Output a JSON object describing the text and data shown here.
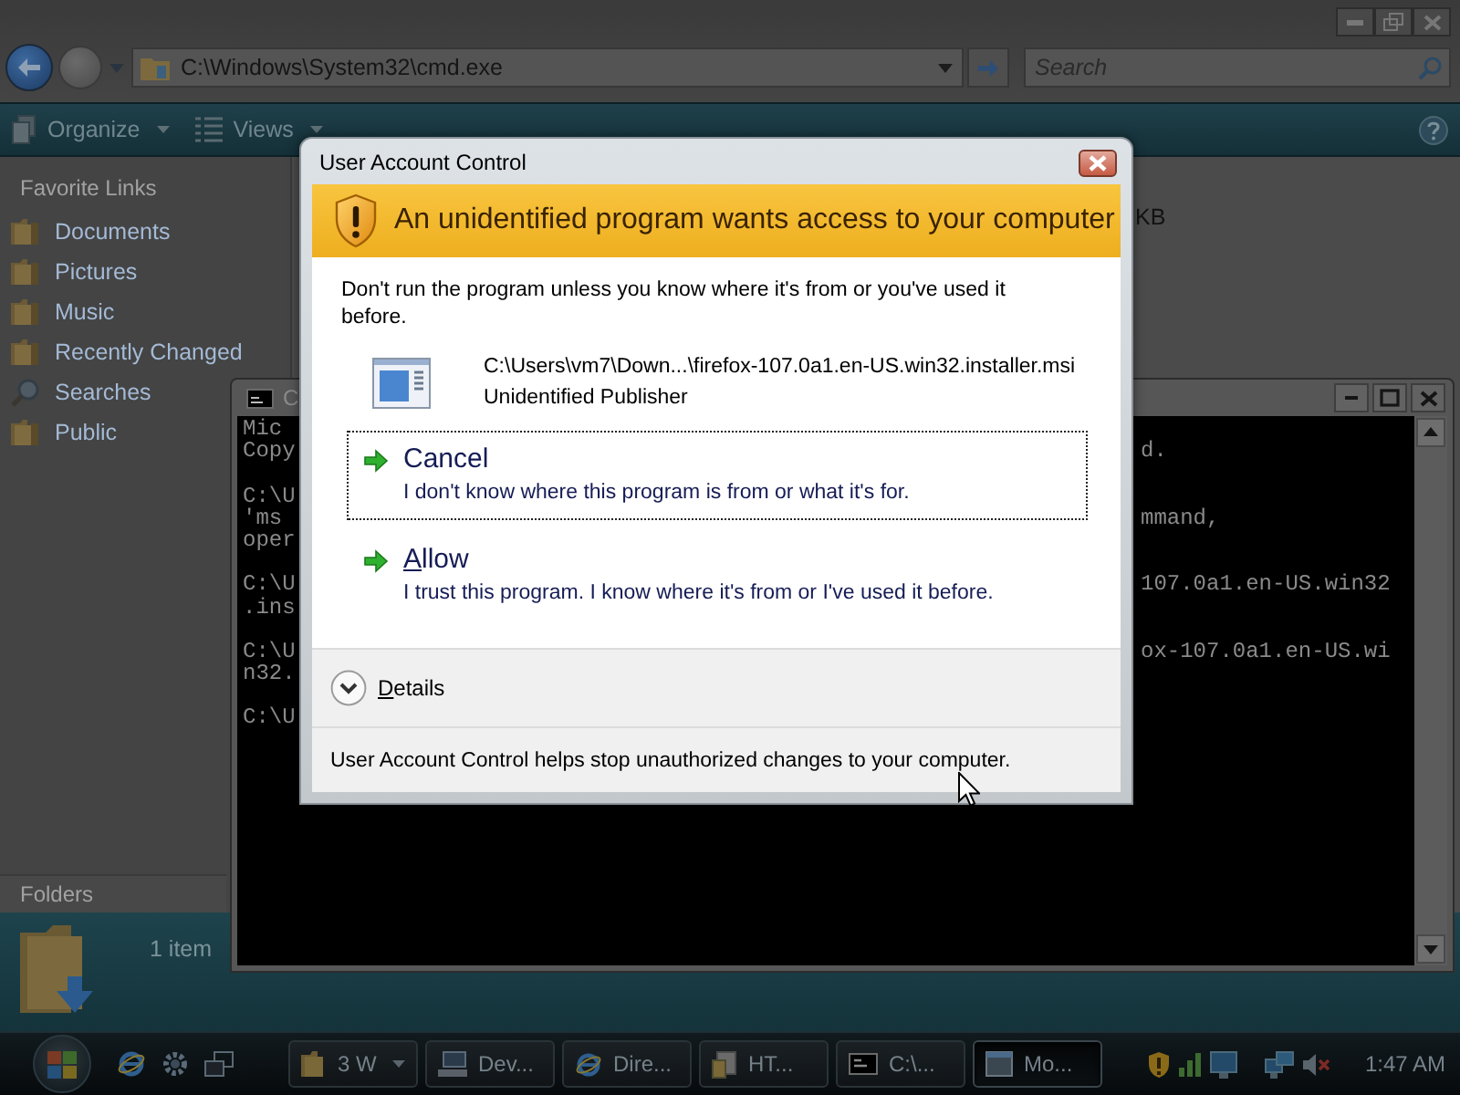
{
  "explorer": {
    "nav_buttons": [
      {
        "kind": "back",
        "disabled": false
      },
      {
        "kind": "forward",
        "disabled": true
      }
    ],
    "address": "C:\\Windows\\System32\\cmd.exe",
    "search": {
      "placeholder": "Search"
    },
    "toolbar": [
      {
        "label": "Organize",
        "kind": "organize"
      },
      {
        "label": "Views",
        "kind": "views"
      }
    ],
    "favorite_links": {
      "heading": "Favorite Links",
      "items": [
        {
          "label": "Documents",
          "kind": "folder"
        },
        {
          "label": "Pictures",
          "kind": "folder"
        },
        {
          "label": "Music",
          "kind": "folder"
        },
        {
          "label": "Recently Changed",
          "kind": "folder"
        },
        {
          "label": "Searches",
          "kind": "search"
        },
        {
          "label": "Public",
          "kind": "folder"
        }
      ]
    },
    "folders_label": "Folders",
    "file_list": {
      "cells": [
        "KB"
      ]
    },
    "status": {
      "item_count": "1 item"
    }
  },
  "console": {
    "title": "C",
    "lines": [
      {
        "kind": "text",
        "left": "Mic"
      },
      {
        "kind": "text",
        "left": "Copy",
        "right": "d."
      },
      {
        "kind": "blank"
      },
      {
        "kind": "text",
        "left": "C:\\U"
      },
      {
        "kind": "text",
        "left": "'ms",
        "right": "mmand,"
      },
      {
        "kind": "text",
        "left": "oper"
      },
      {
        "kind": "blank"
      },
      {
        "kind": "text",
        "left": "C:\\U",
        "right": "107.0a1.en-US.win32"
      },
      {
        "kind": "text",
        "left": ".ins"
      },
      {
        "kind": "blank"
      },
      {
        "kind": "text",
        "left": "C:\\U",
        "right": "ox-107.0a1.en-US.wi"
      },
      {
        "kind": "text",
        "left": "n32."
      },
      {
        "kind": "blank"
      },
      {
        "kind": "text",
        "left": "C:\\U"
      }
    ]
  },
  "dialog": {
    "title": "User Account Control",
    "heading": "An unidentified program wants access to your computer",
    "warning": "Don't run the program unless you know where it's from or you've used it before.",
    "program": {
      "path": "C:\\Users\\vm7\\Down...\\firefox-107.0a1.en-US.win32.installer.msi",
      "publisher": "Unidentified Publisher"
    },
    "options": [
      {
        "label": "Cancel",
        "description": "I don't know where this program is from or what it's for.",
        "focused": true,
        "access_key_underlined": false
      },
      {
        "label": "Allow",
        "description": "I trust this program. I know where it's from or I've used it before.",
        "focused": false,
        "access_key_underlined": true
      }
    ],
    "details": {
      "label": "Details",
      "expanded": false,
      "access_key_underlined": true
    },
    "footer": "User Account Control helps stop unauthorized changes to your computer."
  },
  "taskbar": {
    "tasks": [
      {
        "label": "3 W",
        "kind": "folder",
        "grouped": true,
        "selected": false
      },
      {
        "label": "Dev...",
        "kind": "computer",
        "grouped": false,
        "selected": false
      },
      {
        "label": "Dire...",
        "kind": "browser",
        "grouped": false,
        "selected": false
      },
      {
        "label": "HT...",
        "kind": "document",
        "grouped": false,
        "selected": false
      },
      {
        "label": "C:\\...",
        "kind": "console",
        "grouped": false,
        "selected": false
      },
      {
        "label": "Mo...",
        "kind": "window",
        "grouped": false,
        "selected": true
      }
    ],
    "clock": "1:47 AM"
  }
}
